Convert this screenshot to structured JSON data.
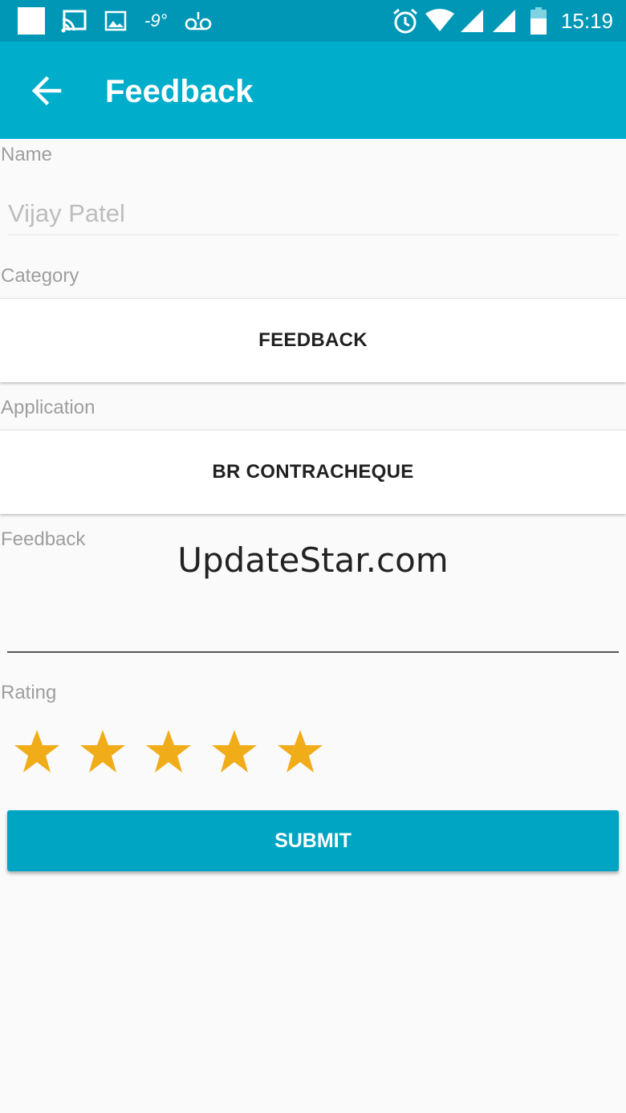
{
  "status_bar": {
    "time": "15:19",
    "temperature": "-9°",
    "icons": [
      "square-notification-icon",
      "cast-icon",
      "image-icon",
      "temperature-icon",
      "voicemail-icon",
      "alarm-icon",
      "wifi-icon",
      "signal-icon",
      "signal-2-icon",
      "battery-icon"
    ]
  },
  "app_bar": {
    "title": "Feedback",
    "back_icon": "arrow-back-icon"
  },
  "form": {
    "name_label": "Name",
    "name_value": "Vijay Patel",
    "category_label": "Category",
    "category_value": "FEEDBACK",
    "application_label": "Application",
    "application_value": "BR CONTRACHEQUE",
    "feedback_label": "Feedback",
    "feedback_value": "UpdateStar.com",
    "rating_label": "Rating",
    "rating_value": 5,
    "rating_max": 5,
    "star_color": "#f0ac19",
    "submit_label": "SUBMIT"
  },
  "colors": {
    "status_bar": "#0097b7",
    "app_bar": "#00aecc",
    "submit_button": "#00a5c4"
  }
}
